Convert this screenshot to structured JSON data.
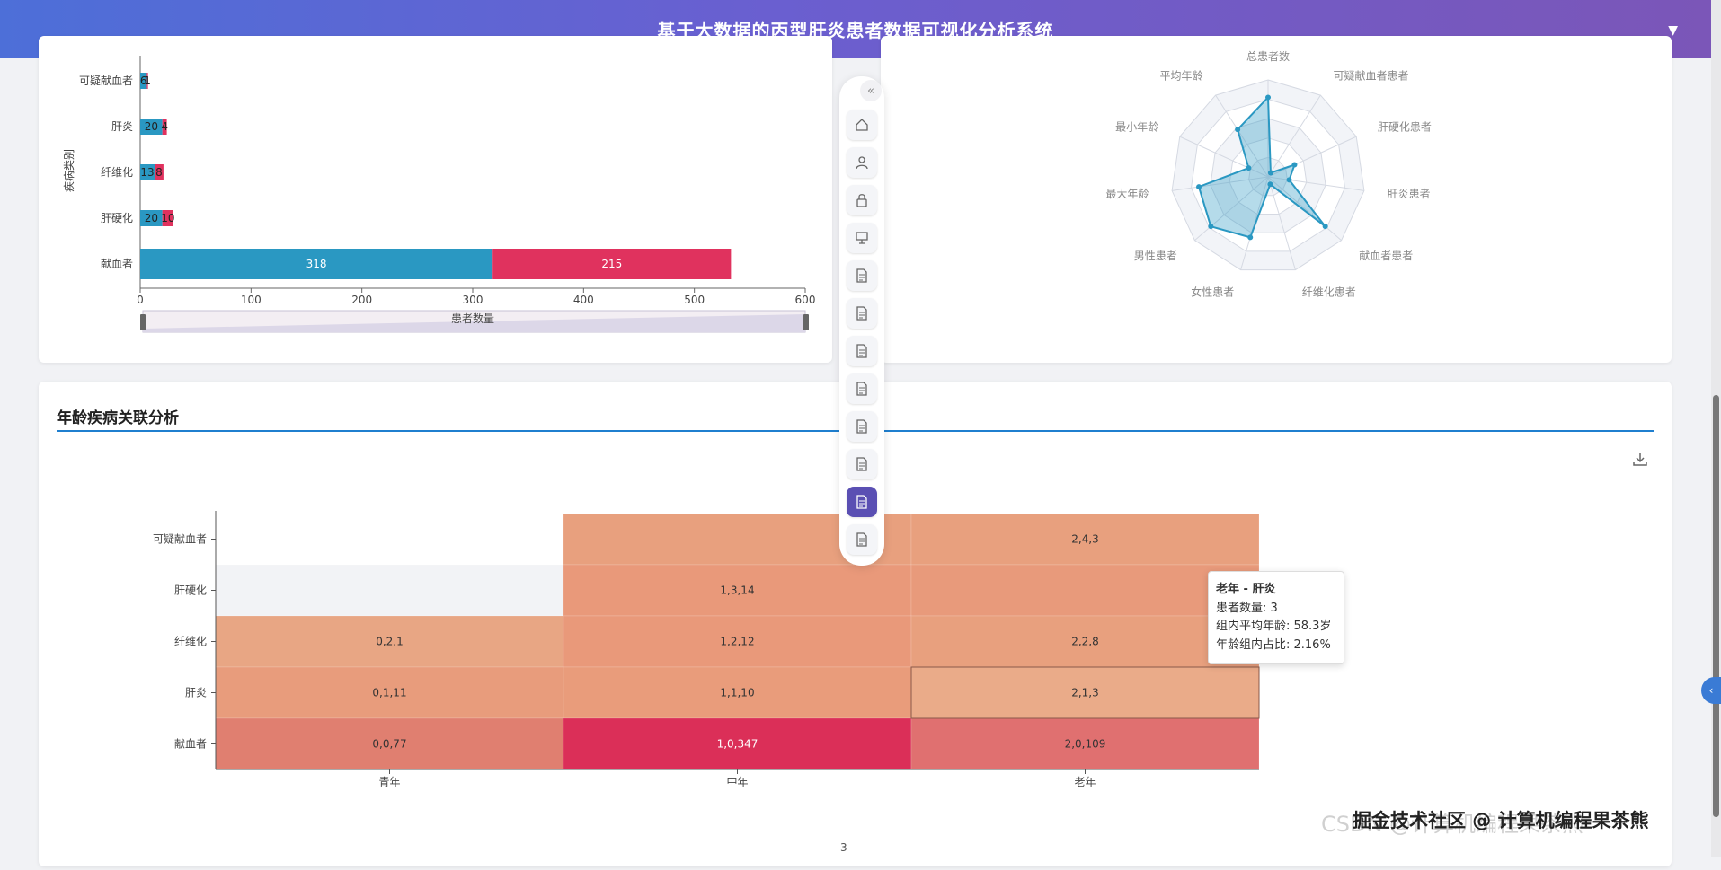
{
  "header": {
    "title": "基于大数据的丙型肝炎患者数据可视化分析系统",
    "caret": "▼"
  },
  "bar_card": {
    "chart_data": {
      "type": "bar",
      "orientation": "horizontal",
      "stacked": true,
      "ylabel": "疾病类别",
      "xlabel": "患者数量",
      "xlim": [
        0,
        600
      ],
      "xticks": [
        "0",
        "100",
        "200",
        "300",
        "400",
        "500",
        "600"
      ],
      "categories": [
        "可疑献血者",
        "肝炎",
        "纤维化",
        "肝硬化",
        "献血者"
      ],
      "series": [
        {
          "values": [
            6,
            20,
            13,
            20,
            318
          ],
          "color": "#2a98c2"
        },
        {
          "values": [
            1,
            4,
            8,
            10,
            215
          ],
          "color": "#e0325e"
        }
      ],
      "labels": {
        "s1": [
          "6",
          "20",
          "13",
          "20",
          "318"
        ],
        "s2": [
          "1",
          "4",
          "8",
          "10",
          "215"
        ]
      }
    }
  },
  "radar_card": {
    "chart_data": {
      "type": "radar",
      "indicators": [
        "总患者数",
        "可疑献血者患者",
        "肝硬化患者",
        "肝炎患者",
        "献血者患者",
        "纤维化患者",
        "女性患者",
        "男性患者",
        "最大年龄",
        "最小年龄",
        "平均年龄"
      ],
      "values": [
        0.82,
        0.05,
        0.3,
        0.22,
        0.78,
        0.08,
        0.65,
        0.78,
        0.72,
        0.22,
        0.58
      ],
      "color": "#2a98c2"
    }
  },
  "heatmap_card": {
    "title": "年龄疾病关联分析",
    "chart_data": {
      "type": "heatmap",
      "x_categories": [
        "青年",
        "中年",
        "老年"
      ],
      "y_categories": [
        "可疑献血者",
        "肝硬化",
        "纤维化",
        "肝炎",
        "献血者"
      ],
      "cells": [
        {
          "x": "中年",
          "y": "可疑献血者",
          "label": "",
          "color": "#e8a07e"
        },
        {
          "x": "老年",
          "y": "可疑献血者",
          "label": "2,4,3",
          "color": "#e8a07e"
        },
        {
          "x": "青年",
          "y": "肝硬化",
          "label": "",
          "color": "#f2f3f6"
        },
        {
          "x": "中年",
          "y": "肝硬化",
          "label": "1,3,14",
          "color": "#e9997a"
        },
        {
          "x": "老年",
          "y": "肝硬化",
          "label": "",
          "color": "#e89a7b"
        },
        {
          "x": "青年",
          "y": "纤维化",
          "label": "0,2,1",
          "color": "#e8a684"
        },
        {
          "x": "中年",
          "y": "纤维化",
          "label": "1,2,12",
          "color": "#e9997a"
        },
        {
          "x": "老年",
          "y": "纤维化",
          "label": "2,2,8",
          "color": "#e8a07e"
        },
        {
          "x": "青年",
          "y": "肝炎",
          "label": "0,1,11",
          "color": "#e89c7c"
        },
        {
          "x": "中年",
          "y": "肝炎",
          "label": "1,1,10",
          "color": "#e99c7b"
        },
        {
          "x": "老年",
          "y": "肝炎",
          "label": "2,1,3",
          "color": "#eaab89"
        },
        {
          "x": "青年",
          "y": "献血者",
          "label": "0,0,77",
          "color": "#e07f70"
        },
        {
          "x": "中年",
          "y": "献血者",
          "label": "1,0,347",
          "color": "#db2f58"
        },
        {
          "x": "老年",
          "y": "献血者",
          "label": "2,0,109",
          "color": "#e07070"
        }
      ]
    }
  },
  "tooltip": {
    "title": "老年 - 肝炎",
    "line1": "患者数量: 3",
    "line2": "组内平均年龄: 58.3岁",
    "line3": "年龄组内占比: 2.16%"
  },
  "floatbar": {
    "collapse": "«",
    "buttons": [
      {
        "name": "home-icon",
        "active": false
      },
      {
        "name": "user-icon",
        "active": false
      },
      {
        "name": "lock-icon",
        "active": false
      },
      {
        "name": "presentation-icon",
        "active": false
      },
      {
        "name": "document-icon",
        "active": false
      },
      {
        "name": "document-icon",
        "active": false
      },
      {
        "name": "document-icon",
        "active": false
      },
      {
        "name": "document-icon",
        "active": false
      },
      {
        "name": "document-icon",
        "active": false
      },
      {
        "name": "document-icon",
        "active": false
      },
      {
        "name": "document-icon",
        "active": true
      },
      {
        "name": "document-icon",
        "active": false
      }
    ]
  },
  "watermark": "CSDN @计算机编程果茶熊",
  "watermark_overlay": "掘金技术社区 @ 计算机编程果茶熊",
  "page_number": "3",
  "side_tab": "‹"
}
